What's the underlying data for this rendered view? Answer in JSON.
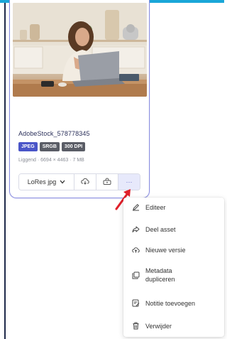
{
  "asset": {
    "filename": "AdobeStock_578778345",
    "tags": [
      "JPEG",
      "SRGB",
      "300 DPI"
    ],
    "meta": "Liggend · 6694 × 4463 · 7 MB"
  },
  "actions": {
    "format_select": "LoRes jpg",
    "download_icon": "cloud-download-icon",
    "share_icon": "share-box-icon",
    "more_label": "···"
  },
  "menu": {
    "items": [
      {
        "label": "Editeer",
        "icon": "pencil-icon"
      },
      {
        "label": "Deel asset",
        "icon": "share-icon"
      },
      {
        "label": "Nieuwe versie",
        "icon": "cloud-upload-icon"
      },
      {
        "label": "Metadata dupliceren",
        "icon": "duplicate-icon"
      },
      {
        "label": "Notitie toevoegen",
        "icon": "note-icon"
      },
      {
        "label": "Verwijder",
        "icon": "trash-icon"
      }
    ]
  },
  "colors": {
    "accent": "#4a55c8",
    "card_border": "#8b8fe0",
    "top_bar": "#1aa6d8",
    "pointer_arrow": "#e0202a"
  }
}
